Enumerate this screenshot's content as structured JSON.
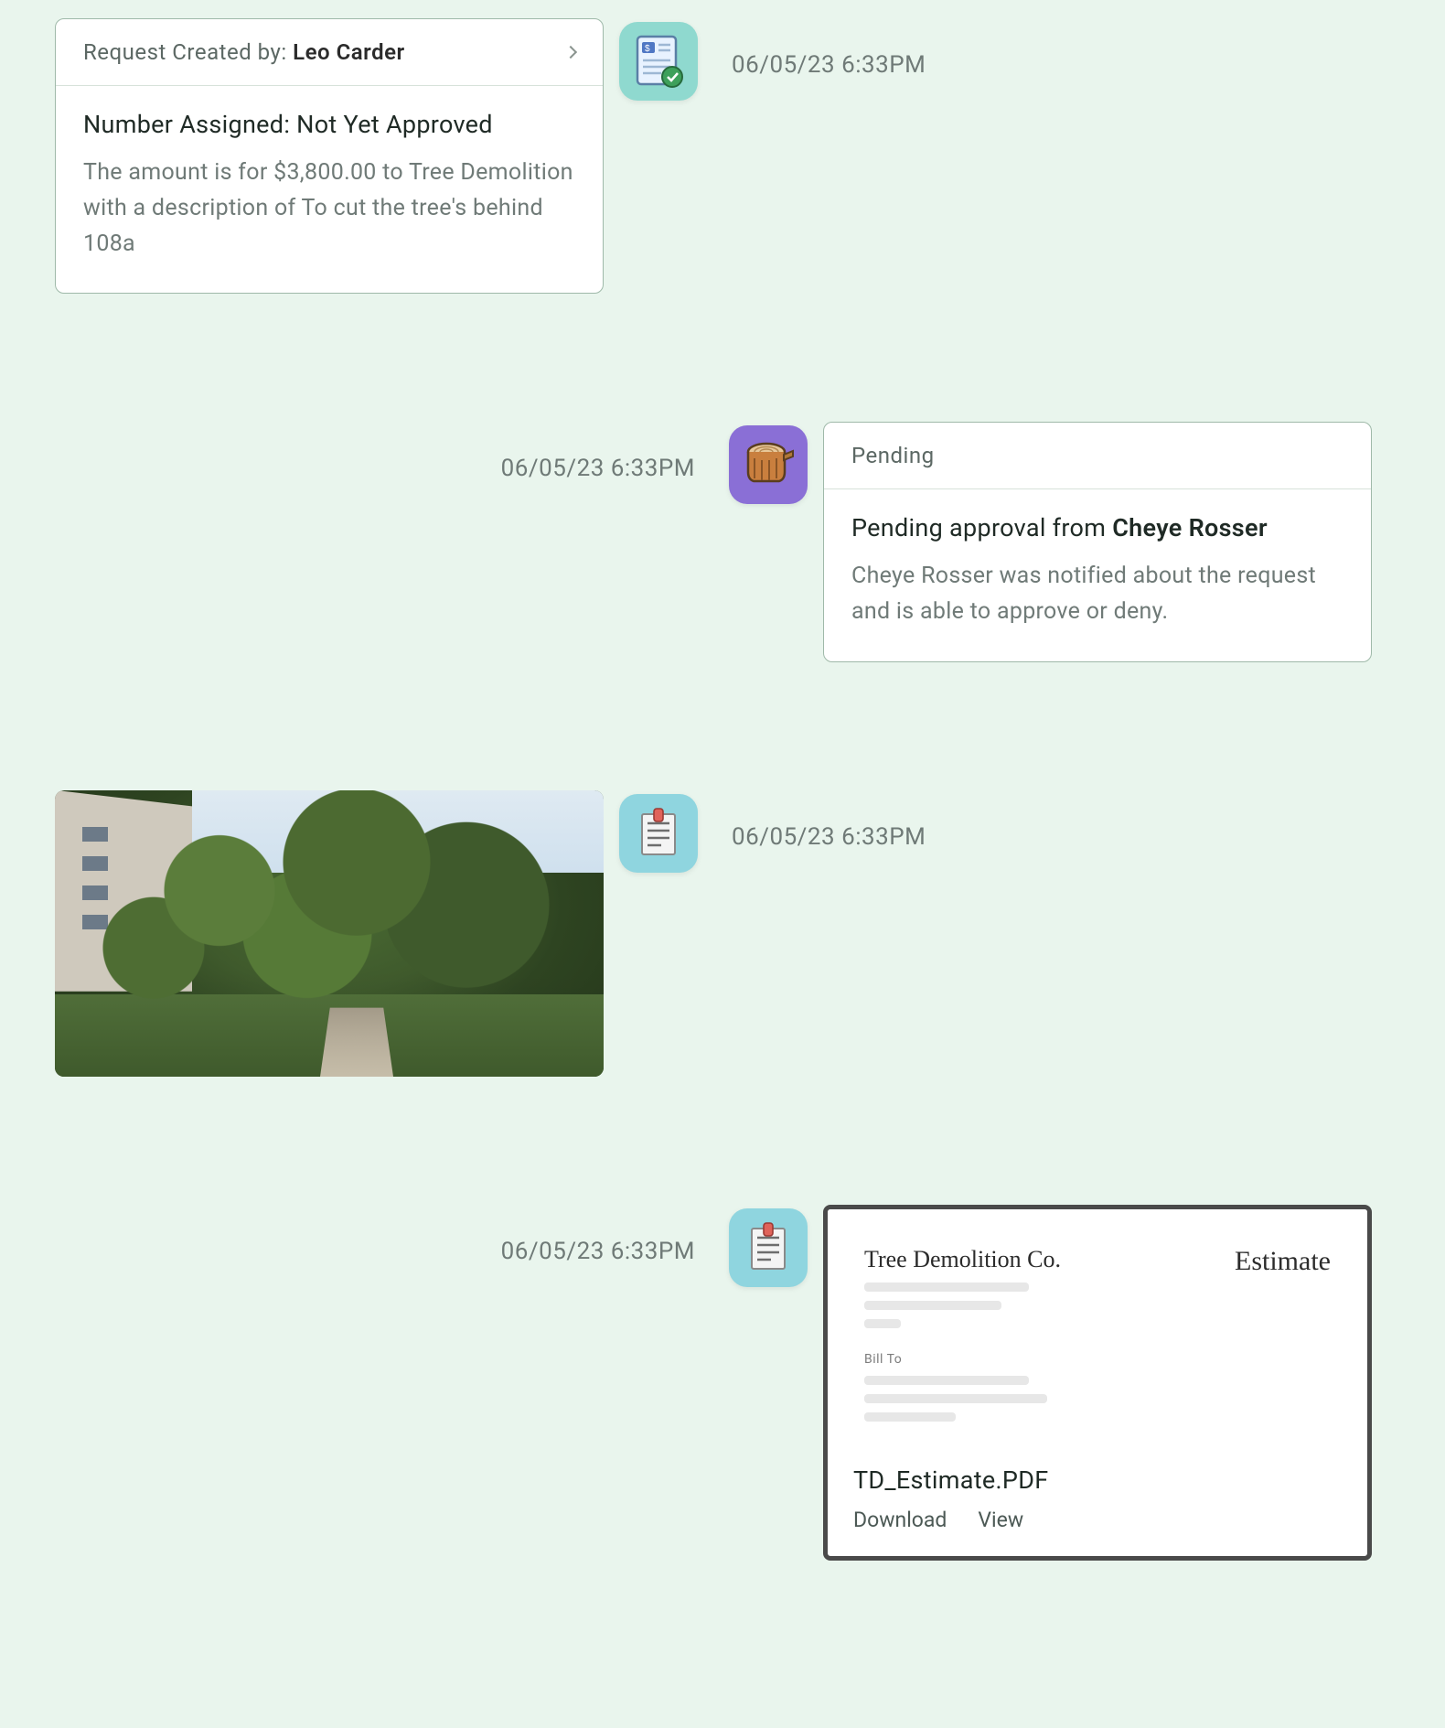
{
  "items": [
    {
      "side": "left",
      "avatar": "invoice-check",
      "timestamp": "06/05/23 6:33PM",
      "header_prefix": "Request Created by:",
      "header_name": "Leo Carder",
      "title": "Number Assigned: Not Yet Approved",
      "body": "The amount is for $3,800.00 to Tree Demolition with a description of To cut the tree's behind 108a"
    },
    {
      "side": "right",
      "avatar": "tree-stump",
      "timestamp": "06/05/23 6:33PM",
      "header_prefix": "Pending",
      "title_prefix": "Pending approval from",
      "title_name": "Cheye Rosser",
      "body_name": "Cheye Rosser",
      "body_suffix": "was notified about the request and is able to approve or deny."
    },
    {
      "side": "left",
      "avatar": "note-clip",
      "timestamp": "06/05/23 6:33PM",
      "kind": "photo"
    },
    {
      "side": "right",
      "avatar": "note-clip",
      "timestamp": "06/05/23 6:33PM",
      "kind": "attachment",
      "doc_company": "Tree Demolition Co.",
      "doc_label": "Estimate",
      "doc_billto": "Bill To",
      "filename": "TD_Estimate.PDF",
      "download_label": "Download",
      "view_label": "View"
    }
  ]
}
